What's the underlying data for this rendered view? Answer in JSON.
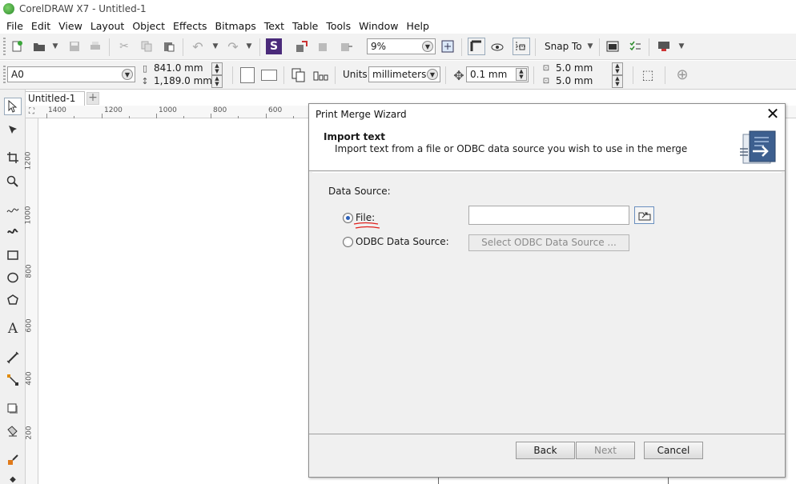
{
  "window": {
    "title": "CorelDRAW X7 - Untitled-1"
  },
  "menu": [
    "File",
    "Edit",
    "View",
    "Layout",
    "Object",
    "Effects",
    "Bitmaps",
    "Text",
    "Table",
    "Tools",
    "Window",
    "Help"
  ],
  "toolbar": {
    "zoom_value": "9%",
    "snap_to_label": "Snap To"
  },
  "property_bar": {
    "page_size": "A0",
    "width": "841.0 mm",
    "height": "1,189.0 mm",
    "units_label": "Units:",
    "units_value": "millimeters",
    "nudge": "0.1 mm",
    "dup_x": "5.0 mm",
    "dup_y": "5.0 mm"
  },
  "document_tabs": [
    {
      "label": "Untitled-1"
    }
  ],
  "rulers": {
    "horizontal": [
      "1400",
      "1200",
      "1000",
      "800",
      "600"
    ],
    "vertical": [
      "1200",
      "1000",
      "800",
      "600",
      "400",
      "200"
    ]
  },
  "dialog": {
    "title": "Print Merge Wizard",
    "header_title": "Import text",
    "header_subtitle": "Import text from a file or ODBC data source you wish to use in the merge",
    "data_source_label": "Data Source:",
    "options": [
      {
        "label": "File:",
        "selected": true
      },
      {
        "label": "ODBC Data Source:",
        "selected": false
      }
    ],
    "file_path_value": "",
    "odbc_button_label": "Select ODBC Data Source ...",
    "buttons": {
      "back": "Back",
      "next": "Next",
      "cancel": "Cancel"
    }
  },
  "colors": {
    "annotation_red": "#e0201c",
    "radio_selected": "#2a5fb8"
  }
}
